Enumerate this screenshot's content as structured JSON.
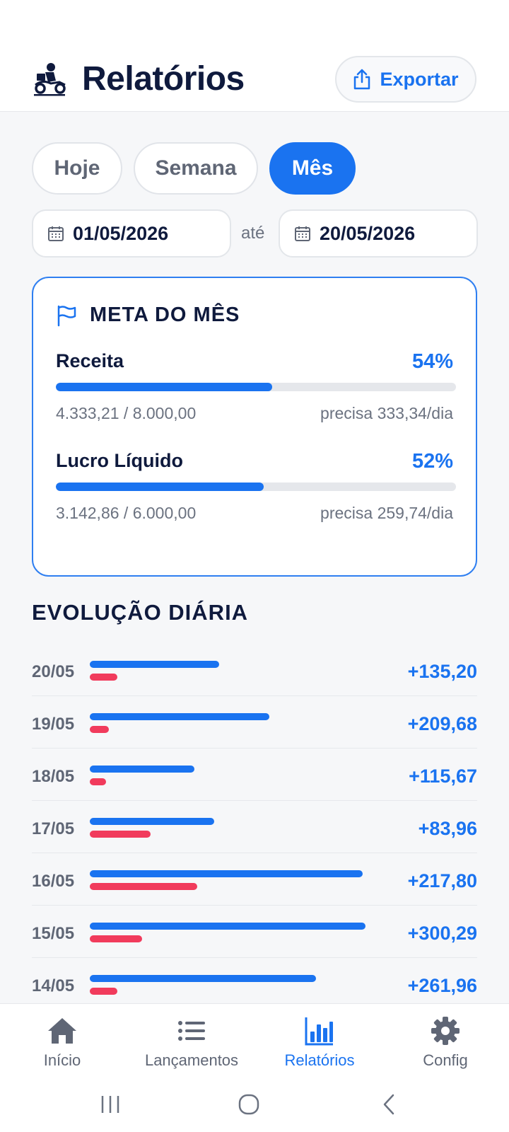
{
  "colors": {
    "accent": "#1a73f0",
    "expense": "#f13b5c",
    "text": "#0f1a3d",
    "muted": "#6b7280"
  },
  "header": {
    "title": "Relatórios",
    "export_label": "Exportar",
    "logo_icon": "motorcycle-delivery-icon",
    "export_icon": "share-upload-icon"
  },
  "period_tabs": [
    {
      "label": "Hoje",
      "active": false
    },
    {
      "label": "Semana",
      "active": false
    },
    {
      "label": "Mês",
      "active": true
    }
  ],
  "date_range": {
    "from": "01/05/2026",
    "separator": "até",
    "to": "20/05/2026",
    "icon": "calendar-icon"
  },
  "goal_card": {
    "title": "META DO MÊS",
    "icon": "flag-icon",
    "metrics": [
      {
        "label": "Receita",
        "percent_text": "54%",
        "progress": 0.54,
        "amounts": "4.333,21 / 8.000,00",
        "need": "precisa 333,34/dia"
      },
      {
        "label": "Lucro Líquido",
        "percent_text": "52%",
        "progress": 0.52,
        "amounts": "3.142,86 / 6.000,00",
        "need": "precisa 259,74/dia"
      }
    ]
  },
  "daily_section": {
    "title": "EVOLUÇÃO DIÁRIA",
    "rows": [
      {
        "date": "20/05",
        "value": "+135,20",
        "income_level": 0.47,
        "expense_level": 0.1
      },
      {
        "date": "19/05",
        "value": "+209,68",
        "income_level": 0.65,
        "expense_level": 0.07
      },
      {
        "date": "18/05",
        "value": "+115,67",
        "income_level": 0.38,
        "expense_level": 0.06
      },
      {
        "date": "17/05",
        "value": "+83,96",
        "income_level": 0.45,
        "expense_level": 0.22
      },
      {
        "date": "16/05",
        "value": "+217,80",
        "income_level": 0.99,
        "expense_level": 0.39
      },
      {
        "date": "15/05",
        "value": "+300,29",
        "income_level": 1.0,
        "expense_level": 0.19
      },
      {
        "date": "14/05",
        "value": "+261,96",
        "income_level": 0.82,
        "expense_level": 0.1
      }
    ]
  },
  "bottom_nav": [
    {
      "label": "Início",
      "icon": "home-icon",
      "active": false
    },
    {
      "label": "Lançamentos",
      "icon": "list-icon",
      "active": false
    },
    {
      "label": "Relatórios",
      "icon": "bar-chart-icon",
      "active": true
    },
    {
      "label": "Config",
      "icon": "gear-icon",
      "active": false
    }
  ]
}
